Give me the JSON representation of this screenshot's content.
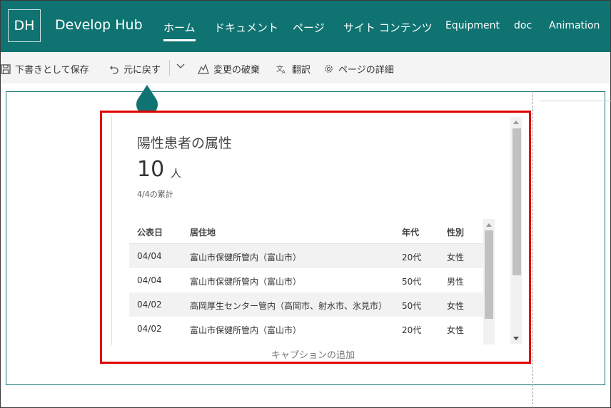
{
  "site": {
    "logo_initials": "DH",
    "title": "Develop Hub"
  },
  "nav": [
    {
      "label": "ホーム",
      "active": true
    },
    {
      "label": "ドキュメント"
    },
    {
      "label": "ページ"
    },
    {
      "label": "サイト コンテンツ"
    },
    {
      "label": "Equipment"
    },
    {
      "label": "doc"
    },
    {
      "label": "Animation"
    }
  ],
  "commands": {
    "save_draft": "下書きとして保存",
    "undo": "元に戻す",
    "discard": "変更の破棄",
    "translate": "翻訳",
    "page_details": "ページの詳細"
  },
  "widget": {
    "title": "陽性患者の属性",
    "count": "10",
    "unit": "人",
    "subtitle": "4/4の累計",
    "columns": [
      "公表日",
      "居住地",
      "年代",
      "性別"
    ],
    "rows": [
      [
        "04/04",
        "富山市保健所管内（富山市）",
        "20代",
        "女性"
      ],
      [
        "04/04",
        "富山市保健所管内（富山市）",
        "50代",
        "男性"
      ],
      [
        "04/02",
        "高岡厚生センター管内（高岡市、射水市、氷見市）",
        "50代",
        "女性"
      ],
      [
        "04/02",
        "富山市保健所管内（富山市）",
        "20代",
        "女性"
      ]
    ]
  },
  "caption_placeholder": "キャプションの追加",
  "colors": {
    "brand": "#0f7371",
    "highlight": "#e00000"
  }
}
